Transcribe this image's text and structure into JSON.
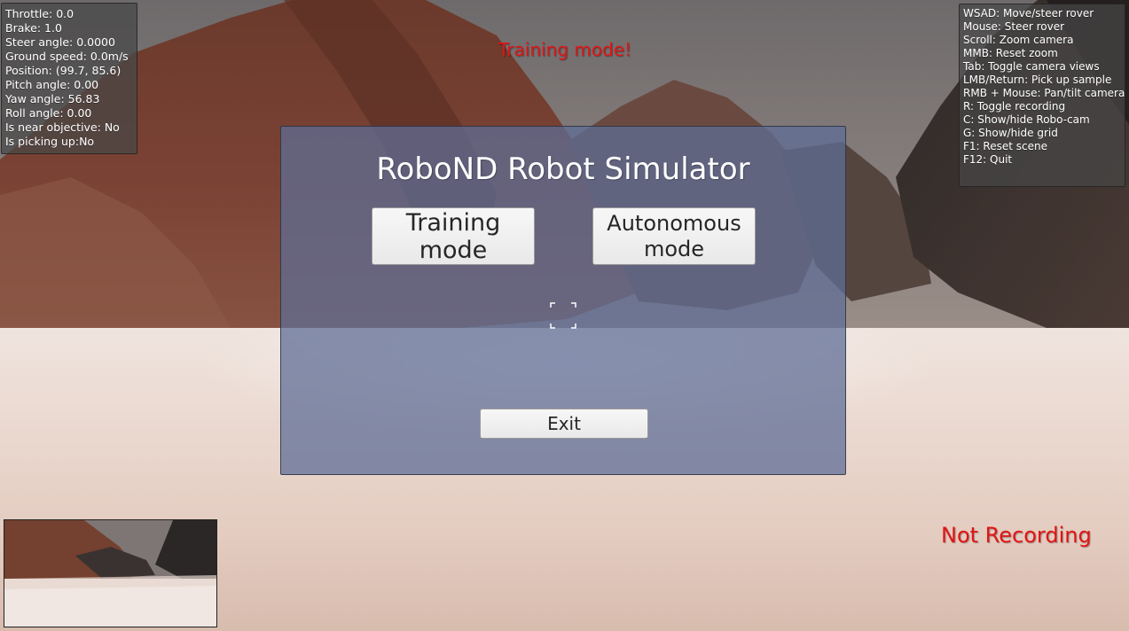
{
  "hud": {
    "stats": [
      "Throttle: 0.0",
      "Brake: 1.0",
      "Steer angle: 0.0000",
      "Ground speed: 0.0m/s",
      "Position: (99.7, 85.6)",
      "Pitch angle: 0.00",
      "Yaw angle: 56.83",
      "Roll angle: 0.00",
      "Is near objective: No",
      "Is picking up:No"
    ],
    "help": [
      "WSAD: Move/steer rover",
      "Mouse: Steer rover",
      "Scroll: Zoom camera",
      "MMB: Reset zoom",
      "Tab: Toggle camera views",
      "LMB/Return: Pick up sample",
      "RMB + Mouse: Pan/tilt camera",
      "R: Toggle recording",
      "C: Show/hide Robo-cam",
      "G: Show/hide grid",
      "F1: Reset scene",
      "F12: Quit"
    ],
    "mode_label": "Training mode!",
    "recording_label": "Not Recording"
  },
  "menu": {
    "title": "RoboND Robot Simulator",
    "training_button": "Training mode",
    "autonomous_button": "Autonomous mode",
    "exit_button": "Exit"
  },
  "colors": {
    "alert_red": "#e01515",
    "panel_blue": "#5e6d96"
  }
}
